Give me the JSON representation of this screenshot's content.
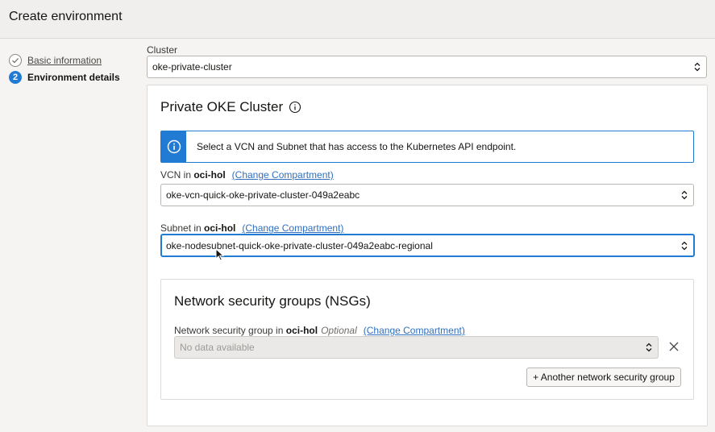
{
  "header": {
    "title": "Create environment"
  },
  "steps": [
    {
      "label": "Basic information",
      "state": "done"
    },
    {
      "label": "Environment details",
      "number": "2",
      "state": "active"
    }
  ],
  "cluster": {
    "label": "Cluster",
    "value": "oke-private-cluster"
  },
  "panel": {
    "title": "Private OKE Cluster",
    "banner_text": "Select a VCN and Subnet that has access to the Kubernetes API endpoint.",
    "vcn": {
      "label_prefix": "VCN in ",
      "compartment": "oci-hol",
      "change_link": "(Change Compartment)",
      "value": "oke-vcn-quick-oke-private-cluster-049a2eabc"
    },
    "subnet": {
      "label_prefix": "Subnet in ",
      "compartment": "oci-hol",
      "change_link": "(Change Compartment)",
      "value": "oke-nodesubnet-quick-oke-private-cluster-049a2eabc-regional"
    }
  },
  "nsg": {
    "title": "Network security groups (NSGs)",
    "label_prefix": "Network security group in ",
    "compartment": "oci-hol",
    "optional": "Optional",
    "change_link": "(Change Compartment)",
    "placeholder": "No data available",
    "add_button": "+ Another network security group"
  },
  "colors": {
    "accent": "#227bd3",
    "link": "#2f6fbe",
    "header_bg": "#f1efed",
    "page_bg": "#f5f4f2"
  },
  "icons": [
    "check-icon",
    "info-icon",
    "info-circle-icon",
    "select-chevron-icon",
    "close-icon",
    "mouse-cursor-icon"
  ]
}
